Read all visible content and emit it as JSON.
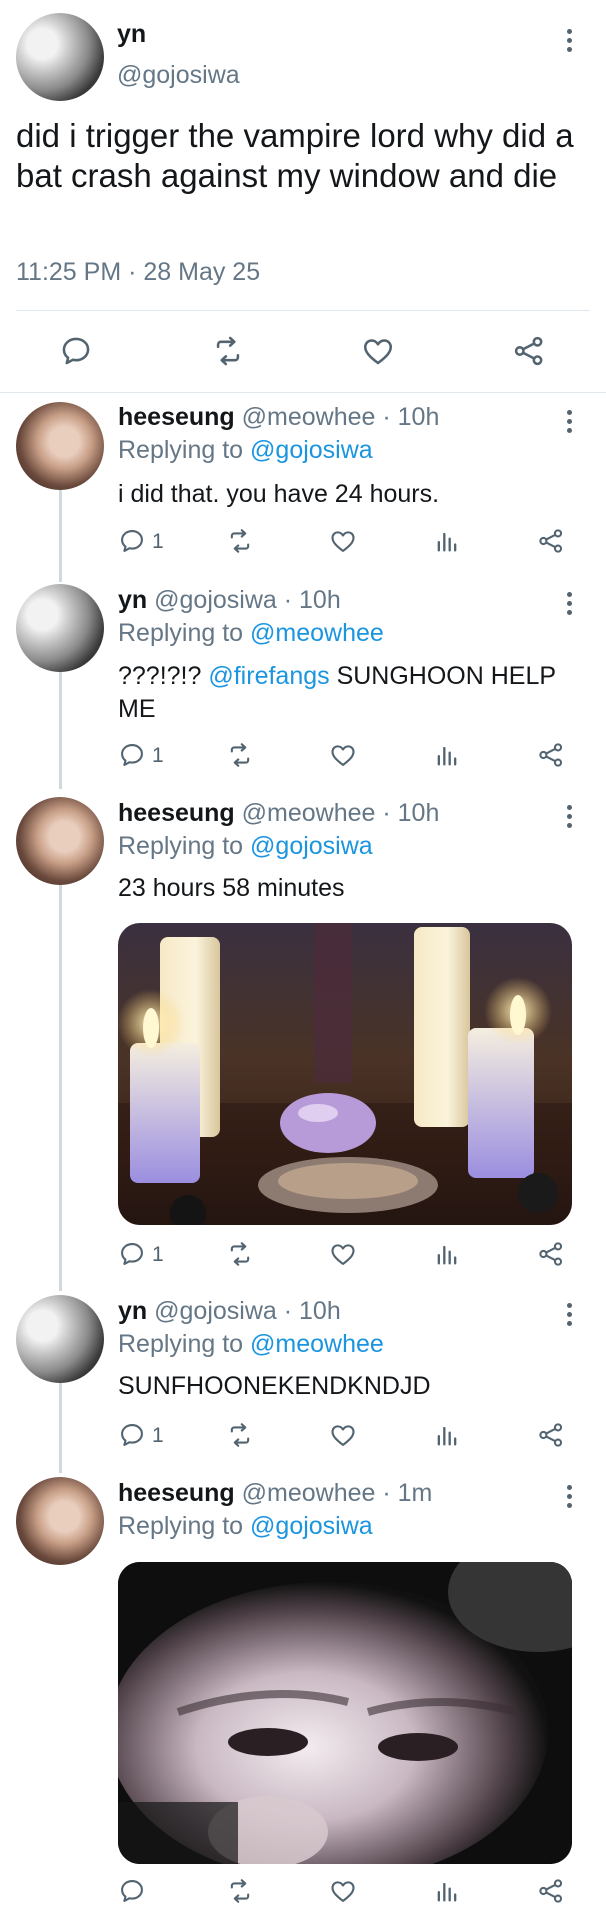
{
  "main_tweet": {
    "name": "yn",
    "handle": "@gojosiwa",
    "text": "did i trigger the vampire lord why did a bat crash against my window and die",
    "timestamp": "11:25 PM · 28 May 25"
  },
  "replies": [
    {
      "name": "heeseung",
      "handle_time": "@meowhee · 10h",
      "replying_prefix": "Replying to ",
      "replying_to": "@gojosiwa",
      "text": "i did that. you have 24 hours.",
      "reply_count": "1"
    },
    {
      "name": "yn",
      "handle_time": "@gojosiwa · 10h",
      "replying_prefix": "Replying to ",
      "replying_to": "@meowhee",
      "text_prefix": "???!?!? ",
      "mention": "@firefangs",
      "text_suffix": " SUNGHOON HELP",
      "text_line2": "ME",
      "reply_count": "1"
    },
    {
      "name": "heeseung",
      "handle_time": "@meowhee · 10h",
      "replying_prefix": "Replying to ",
      "replying_to": "@gojosiwa",
      "text": "23 hours 58 minutes",
      "reply_count": "1"
    },
    {
      "name": "yn",
      "handle_time": "@gojosiwa · 10h",
      "replying_prefix": "Replying to ",
      "replying_to": "@meowhee",
      "text": "SUNFHOONEKENDKNDJD",
      "reply_count": "1"
    },
    {
      "name": "heeseung",
      "handle_time": "@meowhee · 1m",
      "replying_prefix": "Replying to ",
      "replying_to": "@gojosiwa"
    }
  ],
  "colors": {
    "link": "#1b95e0",
    "muted": "#657786",
    "icon": "#536471",
    "thread_line": "#cfd9de"
  },
  "icons": [
    "more-icon",
    "reply-icon",
    "retweet-icon",
    "like-icon",
    "share-icon",
    "analytics-icon"
  ]
}
